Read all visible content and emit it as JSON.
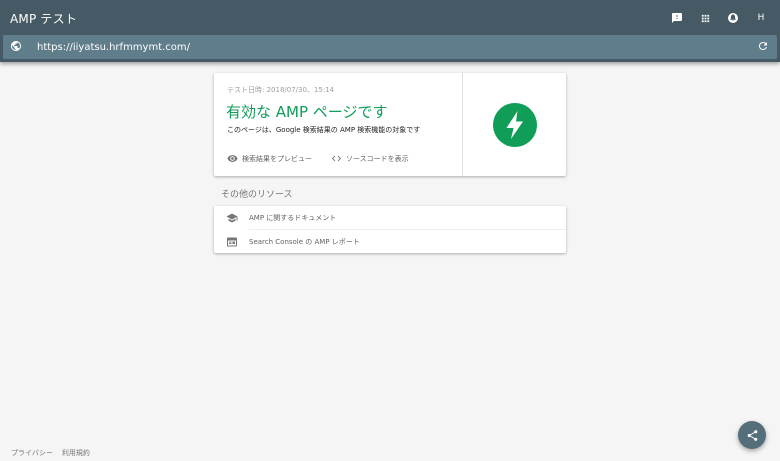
{
  "app": {
    "title": "AMP テスト",
    "account_initial": "H"
  },
  "urlbar": {
    "url": "https://iiyatsu.hrfmmymt.com/"
  },
  "result": {
    "test_date": "テスト日時: 2018/07/30、15:14",
    "headline": "有効な AMP ページです",
    "subtext": "このページは、Google 検索結果の AMP 検索機能の対象です",
    "preview_label": "検索結果をプレビュー",
    "source_label": "ソースコードを表示",
    "status_color": "#0f9d58"
  },
  "resources": {
    "title": "その他のリソース",
    "items": [
      {
        "label": "AMP に関するドキュメント",
        "icon": "school-icon"
      },
      {
        "label": "Search Console の AMP レポート",
        "icon": "report-icon"
      }
    ]
  },
  "footer": {
    "privacy": "プライバシー",
    "terms": "利用規約"
  },
  "colors": {
    "appbar": "#455a64",
    "urlbar": "#607d8b",
    "fab": "#546e7a"
  }
}
